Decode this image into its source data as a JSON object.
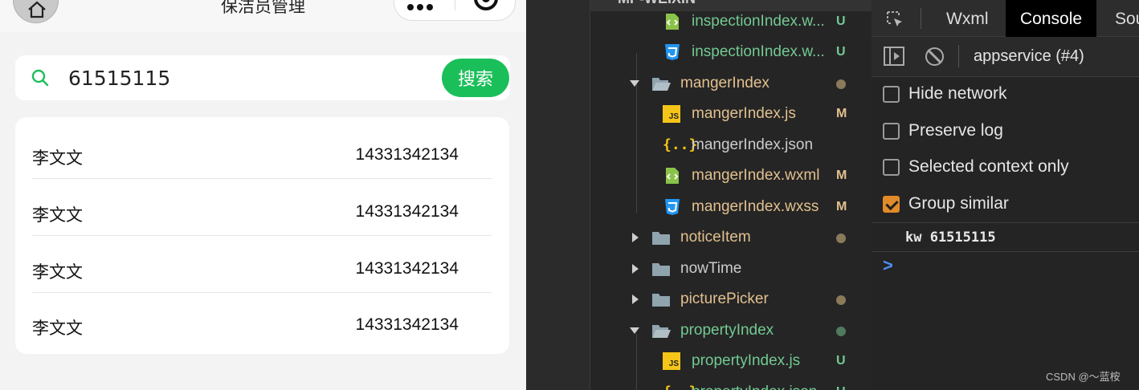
{
  "phone": {
    "title": "保洁员管理",
    "search": {
      "value": "61515115",
      "button_label": "搜索"
    },
    "list": [
      {
        "name": "李文文",
        "phone": "14331342134"
      },
      {
        "name": "李文文",
        "phone": "14331342134"
      },
      {
        "name": "李文文",
        "phone": "14331342134"
      },
      {
        "name": "李文文",
        "phone": "14331342134"
      }
    ]
  },
  "explorer": {
    "header": "MP-WEIXIN",
    "items": [
      {
        "label": "inspectionIndex.w...",
        "icon": "wxml-icon",
        "status": "U",
        "color": "#73c991"
      },
      {
        "label": "inspectionIndex.w...",
        "icon": "wxss-icon",
        "status": "U",
        "color": "#73c991"
      },
      {
        "label": "mangerIndex",
        "icon": "folder-open-icon",
        "dot": true,
        "color": "#e2c08d"
      },
      {
        "label": "mangerIndex.js",
        "icon": "js-icon",
        "status": "M",
        "color": "#e2c08d"
      },
      {
        "label": "mangerIndex.json",
        "icon": "json-icon",
        "status": "",
        "color": "#cccccc"
      },
      {
        "label": "mangerIndex.wxml",
        "icon": "wxml-icon",
        "status": "M",
        "color": "#e2c08d"
      },
      {
        "label": "mangerIndex.wxss",
        "icon": "wxss-icon",
        "status": "M",
        "color": "#e2c08d"
      },
      {
        "label": "noticeItem",
        "icon": "folder-icon",
        "dot": true,
        "color": "#e2c08d"
      },
      {
        "label": "nowTime",
        "icon": "folder-icon",
        "color": "#cccccc"
      },
      {
        "label": "picturePicker",
        "icon": "folder-icon",
        "dot": true,
        "color": "#e2c08d"
      },
      {
        "label": "propertyIndex",
        "icon": "folder-open-icon",
        "dot": true,
        "color": "#73c991"
      },
      {
        "label": "propertyIndex.js",
        "icon": "js-icon",
        "status": "U",
        "color": "#73c991"
      },
      {
        "label": "propertyIndex.json",
        "icon": "json-icon",
        "status": "U",
        "color": "#73c991"
      }
    ]
  },
  "devtools": {
    "tabs": [
      "Wxml",
      "Console",
      "Sou"
    ],
    "active_tab": "Console",
    "context": "appservice (#4)",
    "options": [
      {
        "label": "Hide network",
        "checked": false
      },
      {
        "label": "Preserve log",
        "checked": false
      },
      {
        "label": "Selected context only",
        "checked": false
      },
      {
        "label": "Group similar",
        "checked": true
      }
    ],
    "log": "kw 61515115",
    "prompt": ">",
    "watermark": "CSDN @～蓝桉"
  }
}
